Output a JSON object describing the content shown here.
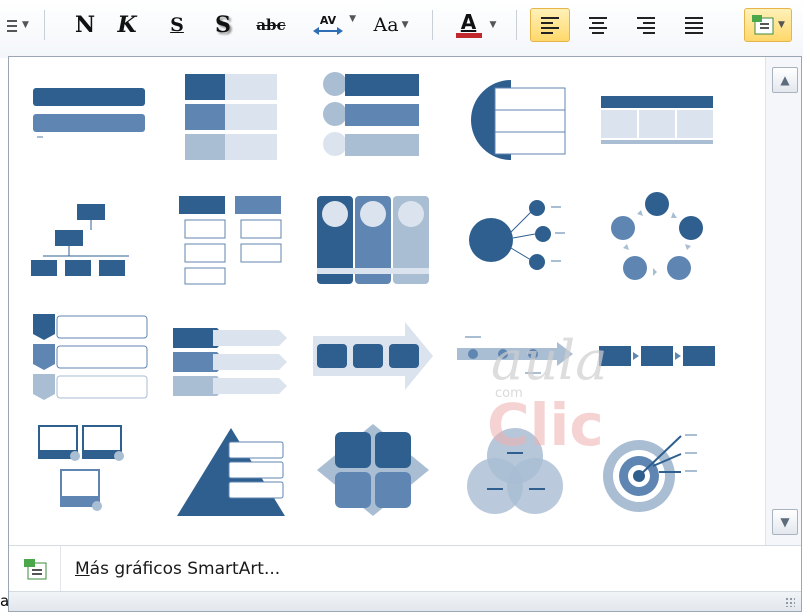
{
  "toolbar": {
    "bold_label": "N",
    "italic_label": "K",
    "underline_label": "S",
    "shadow_label": "S",
    "strike_label": "abc",
    "spacing_label": "AV",
    "case_label": "Aa",
    "font_color_label": "A",
    "font_color": "#c0282c",
    "active_color": "#ffd86b"
  },
  "gallery": {
    "layouts": [
      {
        "icon": "basic-block-list-icon"
      },
      {
        "icon": "vertical-bullet-list-icon"
      },
      {
        "icon": "vertical-circle-list-icon"
      },
      {
        "icon": "half-circle-organization-icon"
      },
      {
        "icon": "table-list-icon"
      },
      {
        "icon": "organization-chart-icon"
      },
      {
        "icon": "hierarchy-list-icon"
      },
      {
        "icon": "vertical-picture-accent-list-icon"
      },
      {
        "icon": "radial-cluster-icon"
      },
      {
        "icon": "basic-cycle-icon"
      },
      {
        "icon": "vertical-chevron-list-icon"
      },
      {
        "icon": "stacked-arrows-icon"
      },
      {
        "icon": "process-arrow-icon"
      },
      {
        "icon": "timeline-process-icon"
      },
      {
        "icon": "basic-process-icon"
      },
      {
        "icon": "picture-caption-list-icon"
      },
      {
        "icon": "segmented-pyramid-icon"
      },
      {
        "icon": "basic-matrix-icon"
      },
      {
        "icon": "basic-venn-icon"
      },
      {
        "icon": "target-icon"
      }
    ],
    "more_label": "Más gráficos SmartArt...",
    "scroll_up": "▲",
    "scroll_down": "▼"
  },
  "watermark": {
    "line1": "aula",
    "line2": "Clic",
    "line3": "com"
  },
  "page_edge_text": "a",
  "colors": {
    "smartart_dark": "#2f5f8f",
    "smartart_light": "#9fb4cc",
    "border": "#9aa6b4"
  }
}
